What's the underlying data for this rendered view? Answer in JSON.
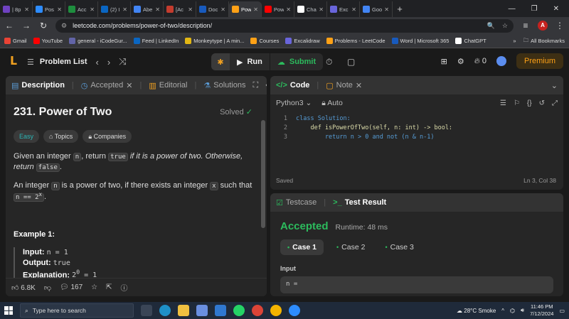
{
  "browser": {
    "tabs": [
      {
        "label": "| 8p",
        "color": "#6f42c1"
      },
      {
        "label": "Pos",
        "color": "#2d8cff"
      },
      {
        "label": "Acc",
        "color": "#1e8e3e"
      },
      {
        "label": "(2) I",
        "color": "#0a66c2"
      },
      {
        "label": "Abe",
        "color": "#4285f4"
      },
      {
        "label": "[Ac",
        "color": "#c43c2e"
      },
      {
        "label": "Doc",
        "color": "#185abd"
      },
      {
        "label": "Pow",
        "color": "#ffa116"
      },
      {
        "label": "Pow",
        "color": "#ff0000"
      },
      {
        "label": "Cha",
        "color": "#ffffff"
      },
      {
        "label": "Exc",
        "color": "#6965db"
      },
      {
        "label": "Goo",
        "color": "#4285f4"
      }
    ],
    "active_tab": 7,
    "url": "leetcode.com/problems/power-of-two/description/",
    "bookmarks": [
      {
        "label": "Gmail",
        "color": "#ea4335"
      },
      {
        "label": "YouTube",
        "color": "#ff0000"
      },
      {
        "label": "general - iCodeGur...",
        "color": "#6264a7"
      },
      {
        "label": "Feed | LinkedIn",
        "color": "#0a66c2"
      },
      {
        "label": "Monkeytype | A min...",
        "color": "#e2b714"
      },
      {
        "label": "Courses",
        "color": "#ffa116"
      },
      {
        "label": "Excalidraw",
        "color": "#6965db"
      },
      {
        "label": "Problems - LeetCode",
        "color": "#ffa116"
      },
      {
        "label": "Word | Microsoft 365",
        "color": "#185abd"
      },
      {
        "label": "ChatGPT",
        "color": "#ffffff"
      }
    ],
    "all_bookmarks": "All Bookmarks",
    "profile_initial": "A"
  },
  "lc_header": {
    "problem_list": "Problem List",
    "run": "Run",
    "submit": "Submit",
    "streak": "0",
    "premium": "Premium"
  },
  "description": {
    "tabs": [
      "Description",
      "Accepted",
      "Editorial",
      "Solutions"
    ],
    "title": "231. Power of Two",
    "solved": "Solved",
    "tags": [
      "Easy",
      "Topics",
      "Companies"
    ],
    "p1_a": "Given an integer ",
    "p1_n": "n",
    "p1_b": ", return ",
    "p1_true": "true",
    "p1_c": " if it is a power of two. Otherwise, return ",
    "p1_false": "false",
    "p1_d": ".",
    "p2_a": "An integer ",
    "p2_n": "n",
    "p2_b": " is a power of two, if there exists an integer ",
    "p2_x": "x",
    "p2_c": " such that ",
    "p2_eq": "n == 2",
    "p2_sup": "x",
    "p2_d": ".",
    "example_title": "Example 1:",
    "ex_input_label": "Input:",
    "ex_input_val": "n = 1",
    "ex_output_label": "Output:",
    "ex_output_val": "true",
    "ex_expl_label": "Explanation:",
    "ex_expl_val": "2",
    "ex_expl_sup": "0",
    "ex_expl_rest": " = 1",
    "likes": "6.8K",
    "comments": "167"
  },
  "code": {
    "tabs": [
      "Code",
      "Note"
    ],
    "language": "Python3",
    "mode": "Auto",
    "lines": [
      {
        "n": "1",
        "text": "class Solution:"
      },
      {
        "n": "2",
        "text": "    def isPowerOfTwo(self, n: int) -> bool:"
      },
      {
        "n": "3",
        "text": "        return n > 0 and not (n & n-1)"
      }
    ],
    "status": "Saved",
    "cursor": "Ln 3, Col 38"
  },
  "result": {
    "tabs": [
      "Testcase",
      "Test Result"
    ],
    "verdict": "Accepted",
    "runtime": "Runtime: 48 ms",
    "cases": [
      "Case 1",
      "Case 2",
      "Case 3"
    ],
    "input_label": "Input",
    "input_value": "n ="
  },
  "taskbar": {
    "search_placeholder": "Type here to search",
    "weather": "28°C  Smoke",
    "time": "11:46 PM",
    "date": "7/12/2024"
  },
  "colors": {
    "accent": "#ffa116",
    "success": "#2cbb5d",
    "bg": "#1a1a1a",
    "panel": "#262626"
  }
}
